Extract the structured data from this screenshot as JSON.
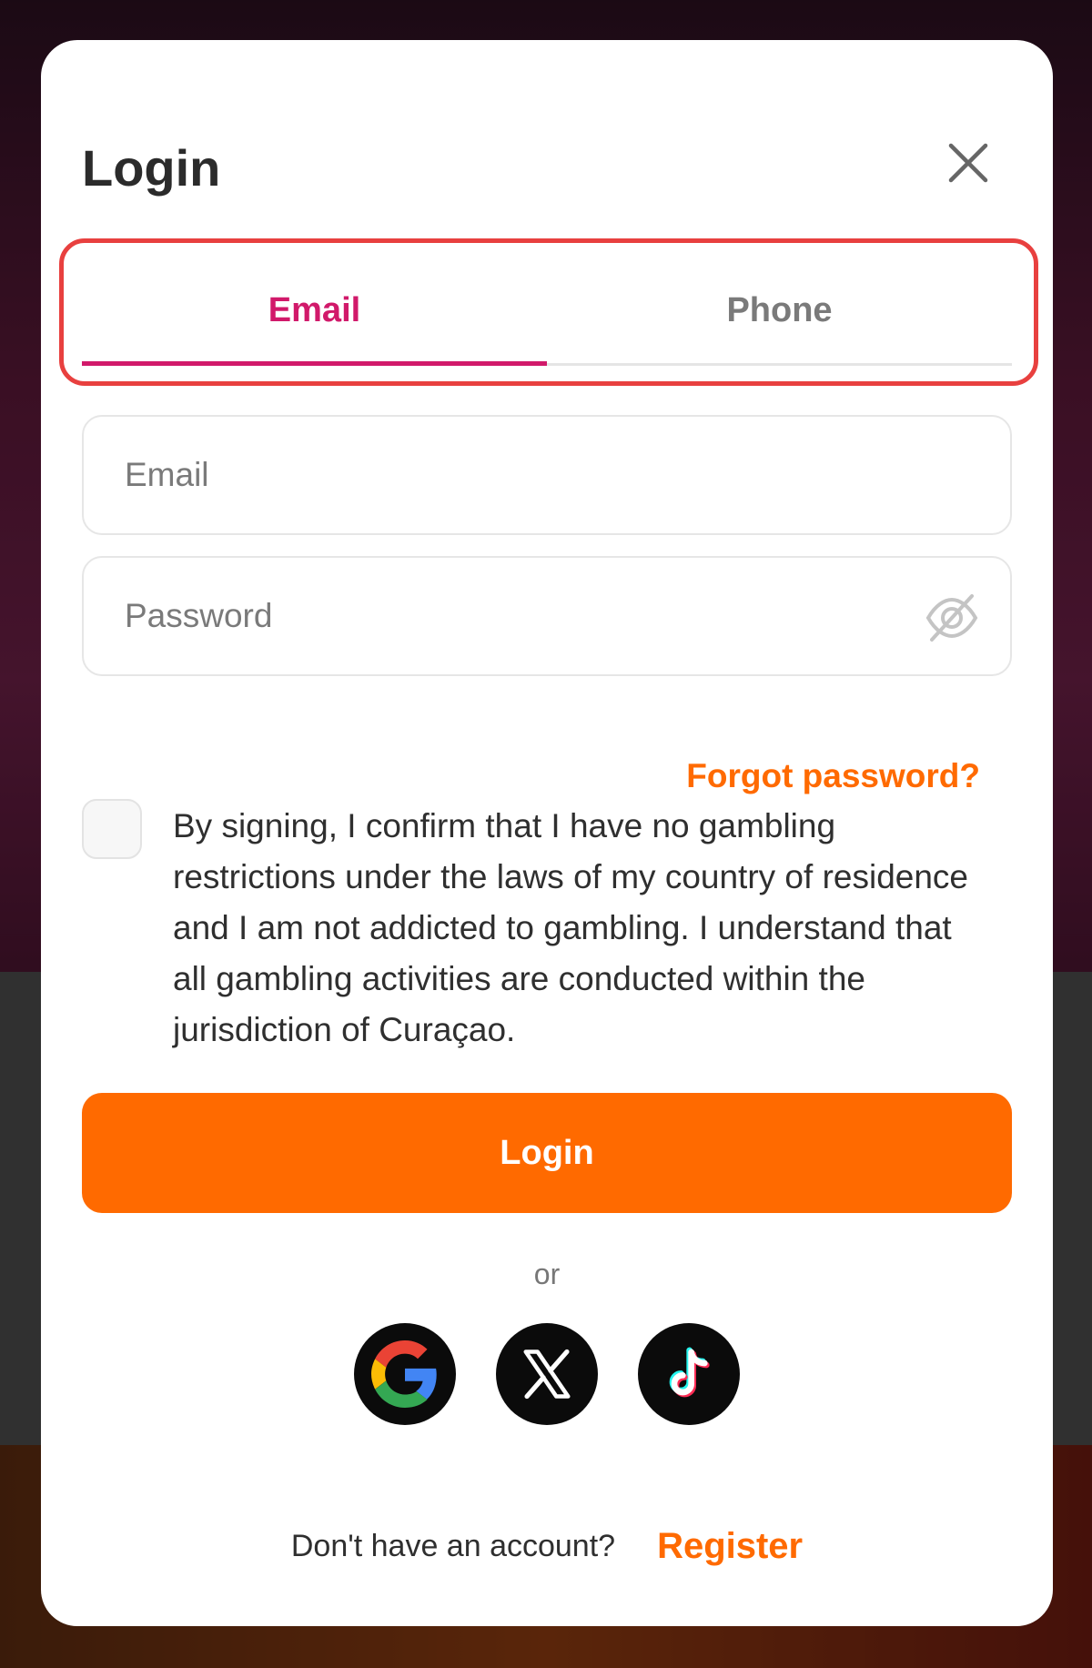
{
  "modal": {
    "title": "Login",
    "tabs": [
      {
        "label": "Email",
        "active": true
      },
      {
        "label": "Phone",
        "active": false
      }
    ],
    "email_field": {
      "placeholder": "Email",
      "value": ""
    },
    "password_field": {
      "placeholder": "Password",
      "value": ""
    },
    "forgot_password": "Forgot password?",
    "terms": "By signing, I confirm that I have no gambling restrictions under the laws of my country of residence and I am not addicted to gambling. I understand that all gambling activities are conducted within the jurisdiction of Curaçao.",
    "terms_checked": false,
    "login_button": "Login",
    "or_label": "or",
    "socials": [
      {
        "icon": "google-icon"
      },
      {
        "icon": "x-icon"
      },
      {
        "icon": "tiktok-icon"
      }
    ],
    "footer": {
      "question": "Don't have an account?",
      "register": "Register"
    }
  },
  "colors": {
    "accent": "#ff6a00",
    "tab_active": "#d1196a",
    "highlight": "#e8403f"
  }
}
